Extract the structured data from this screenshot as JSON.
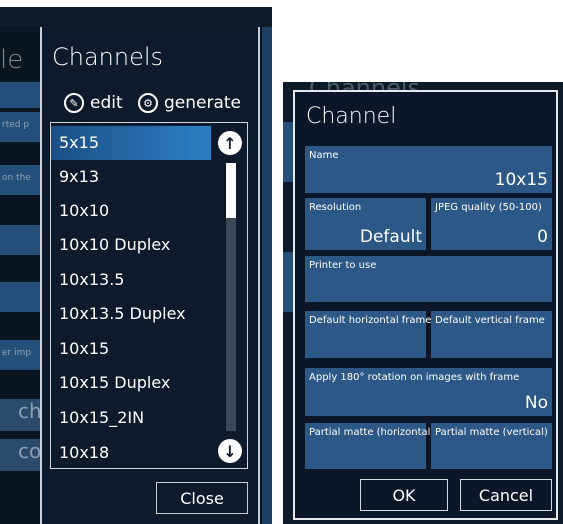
{
  "background_window": {
    "title_fragment": "le",
    "row_texts": [
      "rted p",
      "on the",
      "er imp"
    ],
    "buttons": [
      "ch",
      "co"
    ]
  },
  "channels_dialog": {
    "title": "Channels",
    "edit_label": "edit",
    "generate_label": "generate",
    "items": [
      "5x15",
      "9x13",
      "10x10",
      "10x10 Duplex",
      "10x13.5",
      "10x13.5 Duplex",
      "10x15",
      "10x15 Duplex",
      "10x15_2IN",
      "10x18"
    ],
    "selected_index": 0,
    "close_label": "Close"
  },
  "channel_dialog": {
    "ghost_title": "Channels",
    "title": "Channel",
    "name_label": "Name",
    "name_value": "10x15",
    "resolution_label": "Resolution",
    "resolution_value": "Default",
    "jpeg_label": "JPEG quality (50-100)",
    "jpeg_value": "0",
    "printer_label": "Printer to use",
    "printer_value": "",
    "default_h_frame_label": "Default horizontal frame",
    "default_v_frame_label": "Default vertical frame",
    "rotation_label": "Apply 180° rotation on images with frame",
    "rotation_value": "No",
    "partial_h_label": "Partial matte (horizontal)",
    "partial_v_label": "Partial matte (vertical)",
    "ok_label": "OK",
    "cancel_label": "Cancel"
  },
  "colors": {
    "field_bg": "#2b5886",
    "selection": "#2d7fc2",
    "dialog_bg": "#0b1728"
  }
}
